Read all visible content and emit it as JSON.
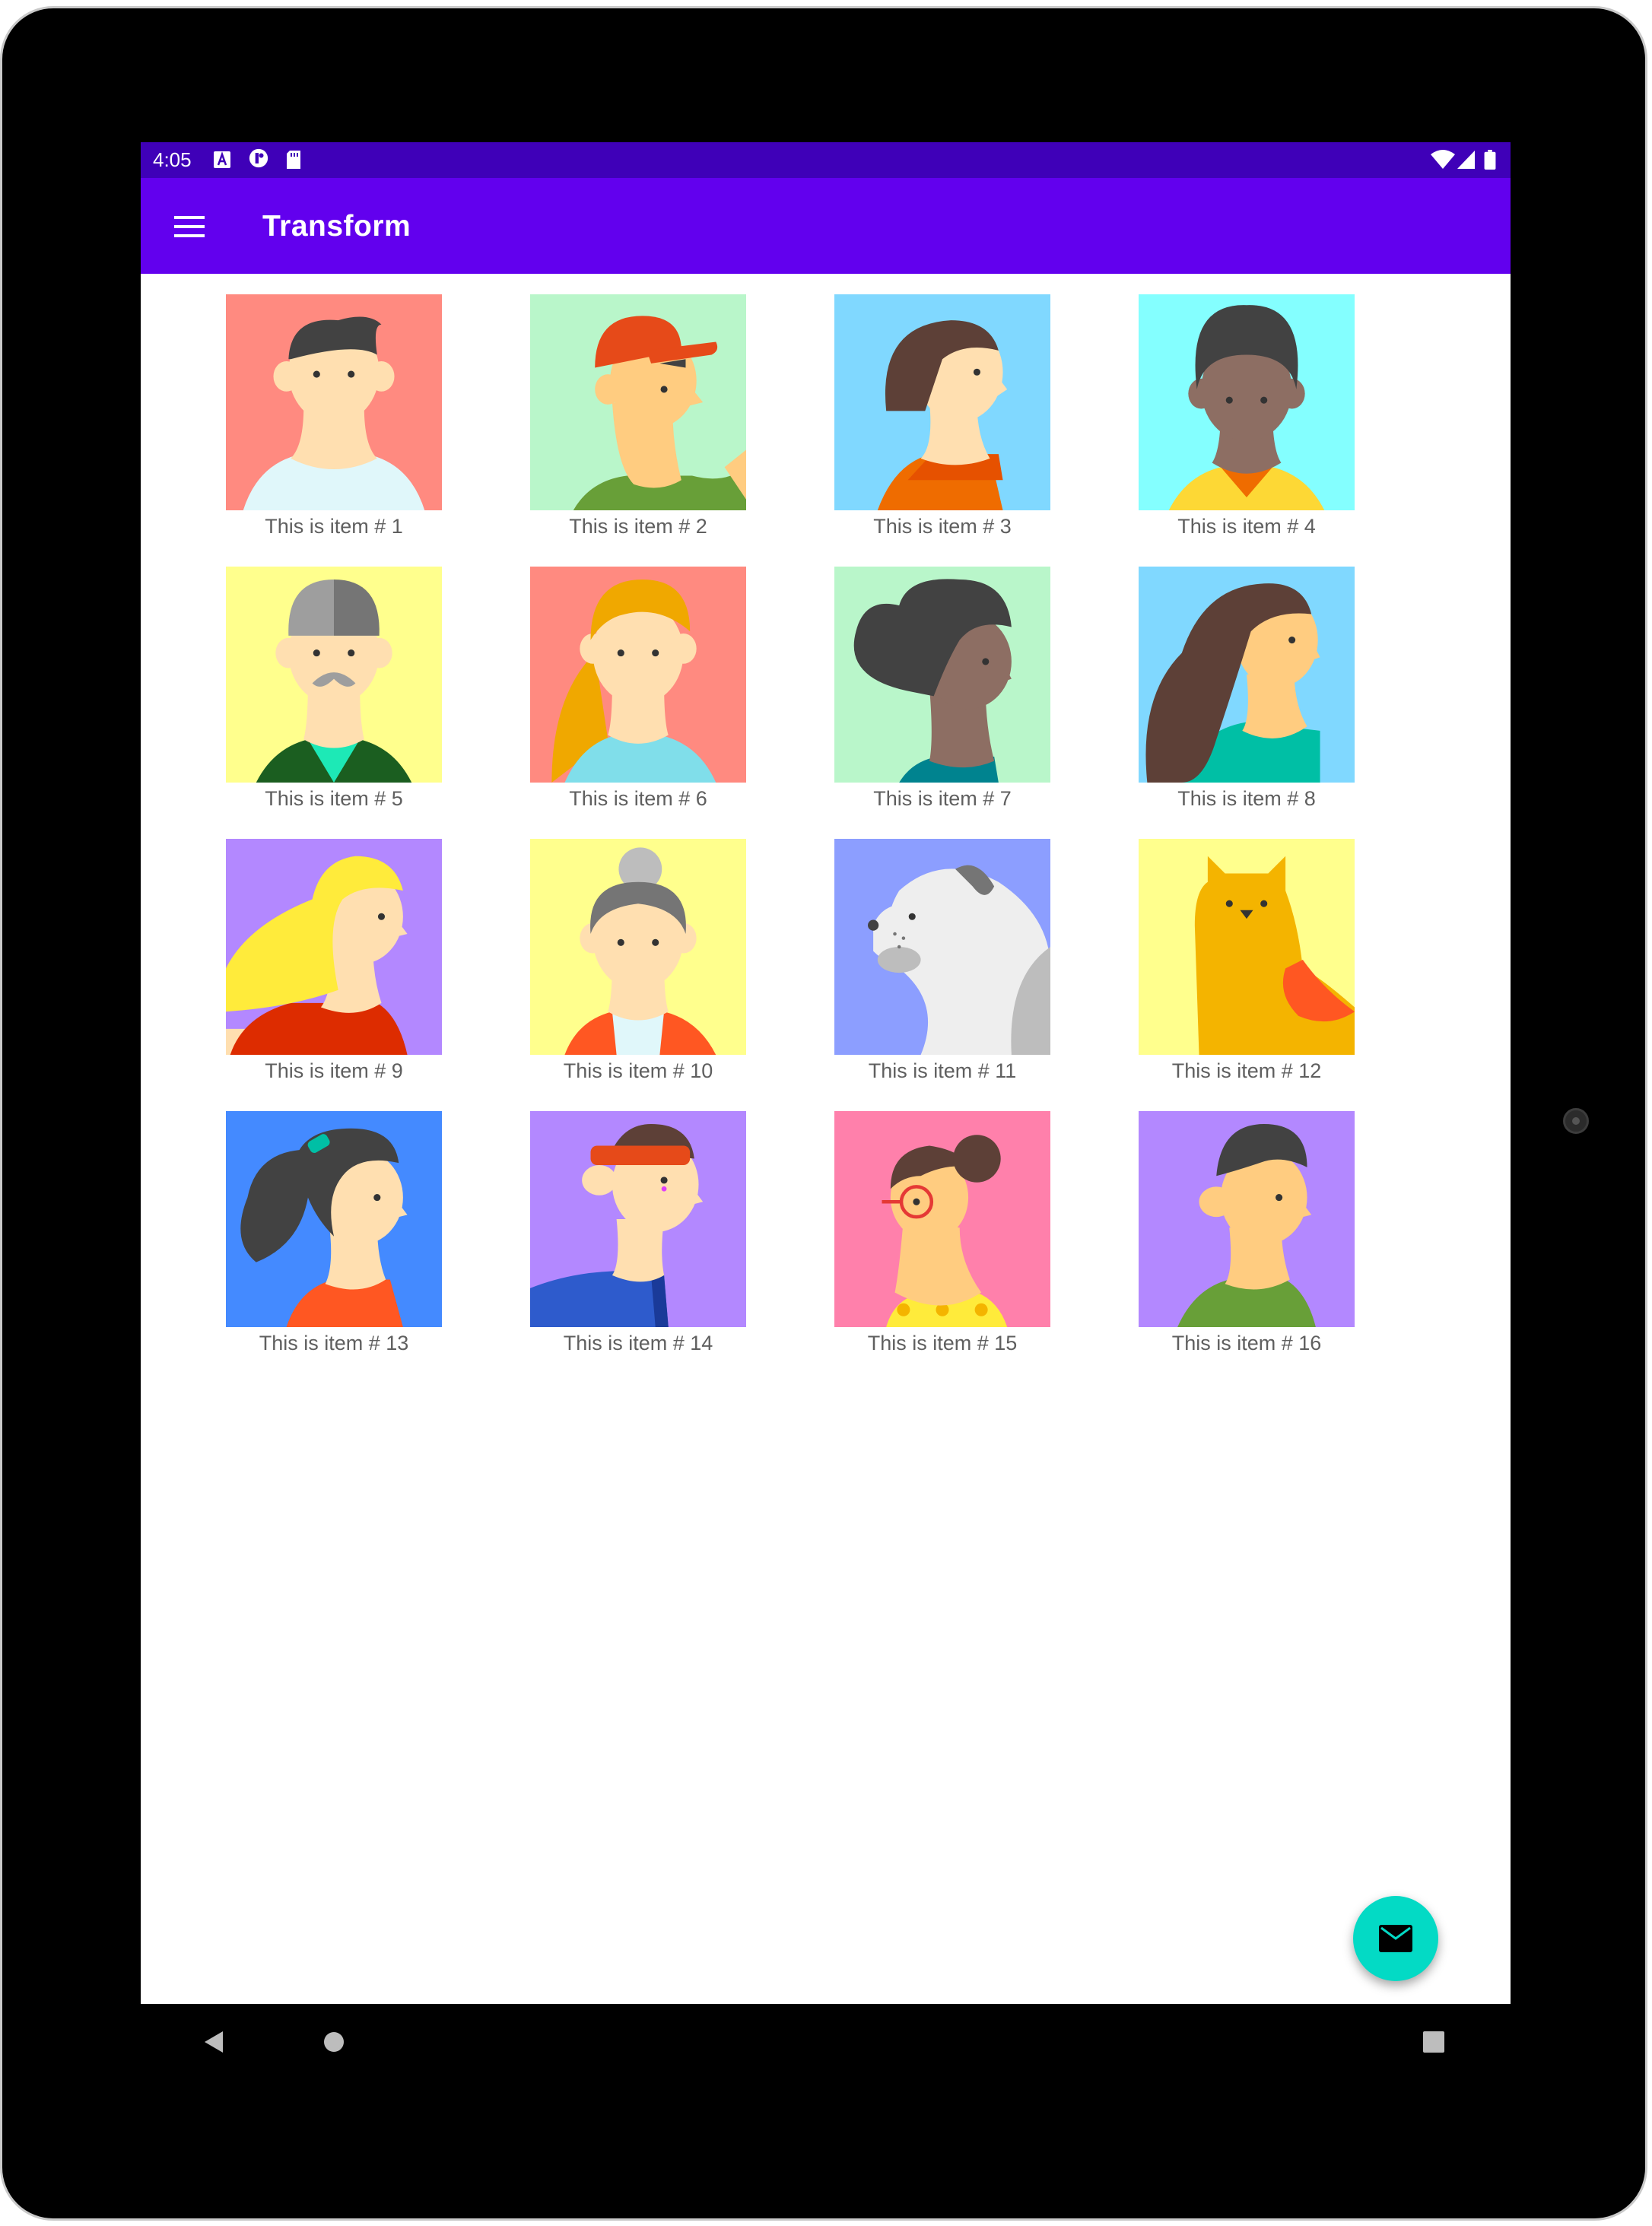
{
  "status_bar": {
    "time": "4:05",
    "left_icons": [
      "a-notification-icon",
      "circle-f-notification-icon",
      "sd-card-icon"
    ],
    "right_icons": [
      "wifi-icon",
      "cell-signal-icon",
      "battery-icon"
    ]
  },
  "app_bar": {
    "title": "Transform",
    "menu_icon": "hamburger-menu-icon",
    "color": "#6200ee",
    "status_color": "#3f00b8"
  },
  "items": [
    {
      "label": "This is item # 1",
      "avatar": "man-black-hair",
      "bg": "#ff8a80"
    },
    {
      "label": "This is item # 2",
      "avatar": "man-red-cap",
      "bg": "#b9f6ca"
    },
    {
      "label": "This is item # 3",
      "avatar": "woman-brown-bob",
      "bg": "#80d8ff"
    },
    {
      "label": "This is item # 4",
      "avatar": "man-dark-skin",
      "bg": "#84ffff"
    },
    {
      "label": "This is item # 5",
      "avatar": "old-man-mustache",
      "bg": "#ffff8d"
    },
    {
      "label": "This is item # 6",
      "avatar": "woman-blonde",
      "bg": "#ff8a80"
    },
    {
      "label": "This is item # 7",
      "avatar": "woman-dark-hair",
      "bg": "#b9f6ca"
    },
    {
      "label": "This is item # 8",
      "avatar": "woman-long-hair",
      "bg": "#80d8ff"
    },
    {
      "label": "This is item # 9",
      "avatar": "woman-yellow-hair",
      "bg": "#b388ff"
    },
    {
      "label": "This is item # 10",
      "avatar": "old-woman-bun",
      "bg": "#ffff8d"
    },
    {
      "label": "This is item # 11",
      "avatar": "dog",
      "bg": "#8c9eff"
    },
    {
      "label": "This is item # 12",
      "avatar": "cat",
      "bg": "#ffff8d"
    },
    {
      "label": "This is item # 13",
      "avatar": "woman-ponytail",
      "bg": "#448aff"
    },
    {
      "label": "This is item # 14",
      "avatar": "man-headband",
      "bg": "#b388ff"
    },
    {
      "label": "This is item # 15",
      "avatar": "woman-glasses",
      "bg": "#ff80ab"
    },
    {
      "label": "This is item # 16",
      "avatar": "man-green-shirt",
      "bg": "#b388ff"
    }
  ],
  "fab": {
    "icon": "email-icon",
    "color": "#03dac5"
  },
  "nav_bar": {
    "icons": [
      "back-icon",
      "home-icon",
      "recents-icon"
    ]
  }
}
